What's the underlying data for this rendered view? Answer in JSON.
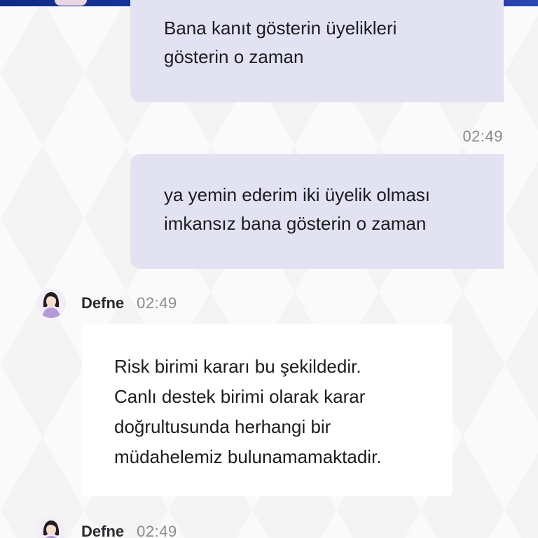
{
  "messages": [
    {
      "direction": "outgoing",
      "lines": [
        "Bana kanıt gösterin üyelikleri",
        "gösterin o zaman"
      ]
    },
    {
      "direction": "outgoing",
      "time": "02:49",
      "lines": [
        "ya yemin ederim iki üyelik olması",
        "imkansız bana gösterin o zaman"
      ]
    },
    {
      "direction": "incoming",
      "sender": "Defne",
      "time": "02:49",
      "lines": [
        "Risk birimi kararı bu şekildedir.",
        "Canlı destek birimi olarak karar",
        "doğrultusunda herhangi bir",
        "müdahelemiz bulunamamaktadir."
      ]
    },
    {
      "direction": "incoming",
      "sender": "Defne",
      "time": "02:49"
    }
  ],
  "colors": {
    "outgoing_bubble": "#e2e2f3",
    "incoming_bubble": "#ffffff",
    "banner": "#1d3aa8",
    "timestamp": "#8b8b8f"
  },
  "icons": {
    "agent_avatar": "female-agent-avatar-icon"
  }
}
